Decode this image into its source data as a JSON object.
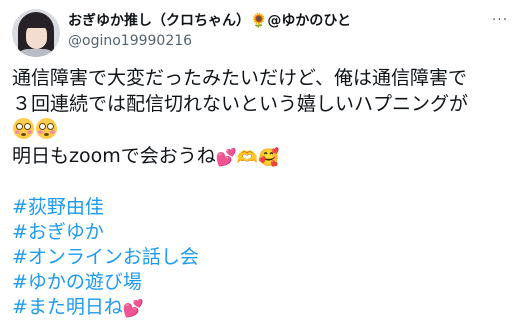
{
  "author": {
    "display_name": "おぎゆか推し（クロちゃん）🌻@ゆかのひと",
    "handle": "@ogino19990216"
  },
  "more_button": "···",
  "tweet": {
    "lines": [
      "通信障害で大変だったみたいだけど、俺は通信障害で",
      "３回連続では配信切れないという嬉しいハプニングが",
      "明日もzoomで会おうね"
    ],
    "emoji": {
      "line2": [
        "flushed-face",
        "flushed-face"
      ],
      "line3_hearts": "💕",
      "line3_hands": "🫶",
      "line3_smile": "🥰",
      "hashtag_last_hearts": "💕"
    },
    "hashtags": [
      "#荻野由佳",
      "#おぎゆか",
      "#オンラインお話し会",
      "#ゆかの遊び場",
      "#また明日ね"
    ]
  },
  "colors": {
    "text": "#0f1419",
    "secondary": "#536471",
    "link": "#1d9bf0"
  }
}
